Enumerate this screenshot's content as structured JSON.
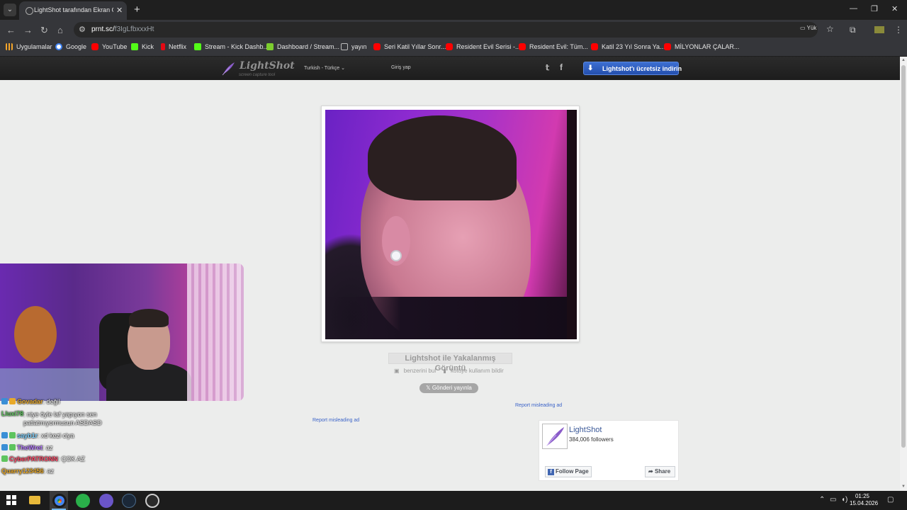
{
  "browser": {
    "tab_title": "LightShot tarafından Ekran Görüntüsü",
    "url_host": "prnt.sc/",
    "url_path": "f3IgLfbxxxHt",
    "cast_label": "Yük",
    "bookmarks": [
      {
        "label": "Uygulamalar",
        "icon": "apps-grid-icon"
      },
      {
        "label": "Google",
        "icon": "google-icon"
      },
      {
        "label": "YouTube",
        "icon": "youtube-icon"
      },
      {
        "label": "Kick",
        "icon": "kick-icon"
      },
      {
        "label": "Netflix",
        "icon": "netflix-icon"
      },
      {
        "label": "Stream - Kick Dashb...",
        "icon": "kick-icon"
      },
      {
        "label": "Dashboard / Stream...",
        "icon": "streamlabs-icon"
      },
      {
        "label": "yayın",
        "icon": "folder-icon"
      },
      {
        "label": "Seri Katil Yıllar Sonr...",
        "icon": "youtube-icon"
      },
      {
        "label": "Resident Evil Serisi -...",
        "icon": "youtube-icon"
      },
      {
        "label": "Resident Evil: Tüm...",
        "icon": "youtube-icon"
      },
      {
        "label": "Katil 23 Yıl Sonra Ya...",
        "icon": "youtube-icon"
      },
      {
        "label": "MİLYONLAR ÇALAR...",
        "icon": "youtube-icon"
      }
    ]
  },
  "lightshot": {
    "logo_name": "LightShot",
    "logo_tagline": "screen capture tool",
    "language": "Turkish - Türkçe",
    "login": "Giriş yap",
    "download": "Lightshot'ı ücretsiz indirin",
    "caption": "Lightshot ile Yakalanmış Görüntü",
    "find_similar": "benzerini bul",
    "report_abuse": "kötüye kullanım bildir",
    "tweet": "Gönderi yayınla",
    "report_ad": "Report misleading ad",
    "facebook": {
      "name": "LightShot",
      "followers": "384,006 followers",
      "follow": "Follow Page",
      "share": "Share"
    }
  },
  "chat": [
    {
      "user": "Govadar",
      "msg": ": değil",
      "color": "#e8a92a"
    },
    {
      "user": "Lluxi78",
      "msg": ": niye öyle laf yapıyon sen patlatmıyormusun ASDASD",
      "color": "#5ec45e"
    },
    {
      "user": "sayb1r",
      "msg": ": xd kezi ciya",
      "color": "#7fd2ff"
    },
    {
      "user": "TheWret",
      "msg": ": az",
      "color": "#b77cff"
    },
    {
      "user": "CyberPATRONN",
      "msg": ": ÇOK AZ",
      "color": "#ff4d6a"
    },
    {
      "user": "Quarry123456",
      "msg": ": az",
      "color": "#e8a92a"
    }
  ],
  "taskbar": {
    "time": "01:25",
    "date": "15.04.2026"
  }
}
